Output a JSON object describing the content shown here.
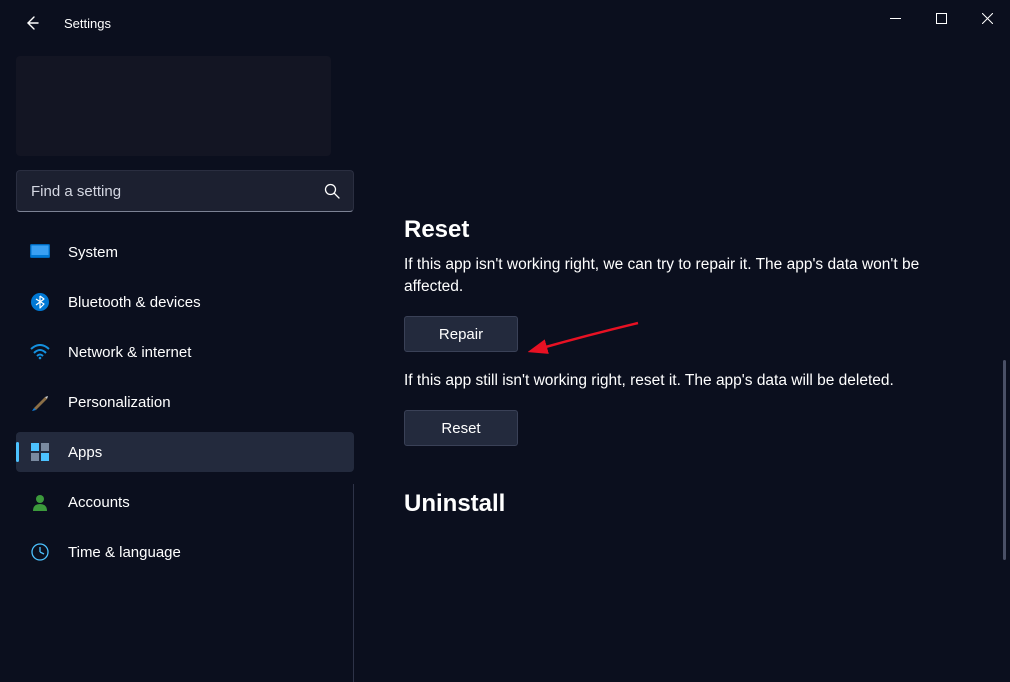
{
  "window": {
    "title": "Settings"
  },
  "search": {
    "placeholder": "Find a setting"
  },
  "nav": {
    "items": [
      {
        "label": "System"
      },
      {
        "label": "Bluetooth & devices"
      },
      {
        "label": "Network & internet"
      },
      {
        "label": "Personalization"
      },
      {
        "label": "Apps"
      },
      {
        "label": "Accounts"
      },
      {
        "label": "Time & language"
      }
    ],
    "selected_index": 4
  },
  "main": {
    "reset": {
      "heading": "Reset",
      "repair_desc": "If this app isn't working right, we can try to repair it. The app's data won't be affected.",
      "repair_btn": "Repair",
      "reset_desc": "If this app still isn't working right, reset it. The app's data will be deleted.",
      "reset_btn": "Reset"
    },
    "uninstall": {
      "heading": "Uninstall"
    }
  }
}
